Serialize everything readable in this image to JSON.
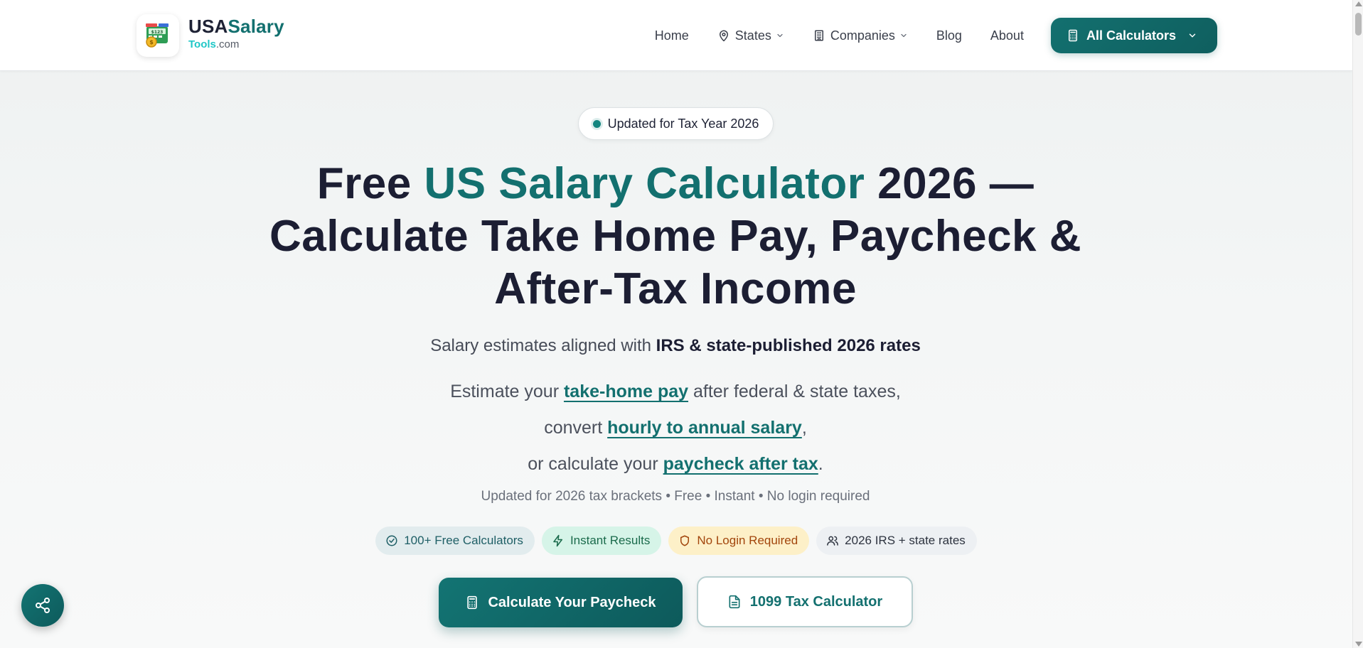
{
  "brand": {
    "name_part1": "USA",
    "name_part2": "Salary",
    "sub_part1": "Tools",
    "sub_part2": ".com",
    "logo_icon": "money-calculator-icon"
  },
  "nav": {
    "home": "Home",
    "states": "States",
    "companies": "Companies",
    "blog": "Blog",
    "about": "About",
    "cta": "All Calculators"
  },
  "hero": {
    "badge": "Updated for Tax Year 2026",
    "title_pre": "Free ",
    "title_accent": "US Salary Calculator",
    "title_post": " 2026 — Calculate Take Home Pay, Paycheck & After-Tax Income",
    "subline_pre": "Salary estimates aligned with ",
    "subline_bold": "IRS & state-published 2026 rates",
    "desc_line1_pre": "Estimate your ",
    "desc_line1_link": "take-home pay",
    "desc_line1_post": " after federal & state taxes,",
    "desc_line2_pre": "convert ",
    "desc_line2_link": "hourly to annual salary",
    "desc_line2_post": ",",
    "desc_line3_pre": "or calculate your ",
    "desc_line3_link": "paycheck after tax",
    "desc_line3_post": ".",
    "meta": "Updated for 2026 tax brackets • Free • Instant • No login required"
  },
  "pills": [
    {
      "label": "100+ Free Calculators",
      "icon": "check-circle-icon"
    },
    {
      "label": "Instant Results",
      "icon": "lightning-icon"
    },
    {
      "label": "No Login Required",
      "icon": "shield-icon"
    },
    {
      "label": "2026 IRS + state rates",
      "icon": "users-icon"
    }
  ],
  "buttons": {
    "primary": "Calculate Your Paycheck",
    "secondary": "1099 Tax Calculator"
  },
  "colors": {
    "accent": "#13706f",
    "accent_light": "#20c7c7",
    "text_dark": "#1c1e33"
  }
}
